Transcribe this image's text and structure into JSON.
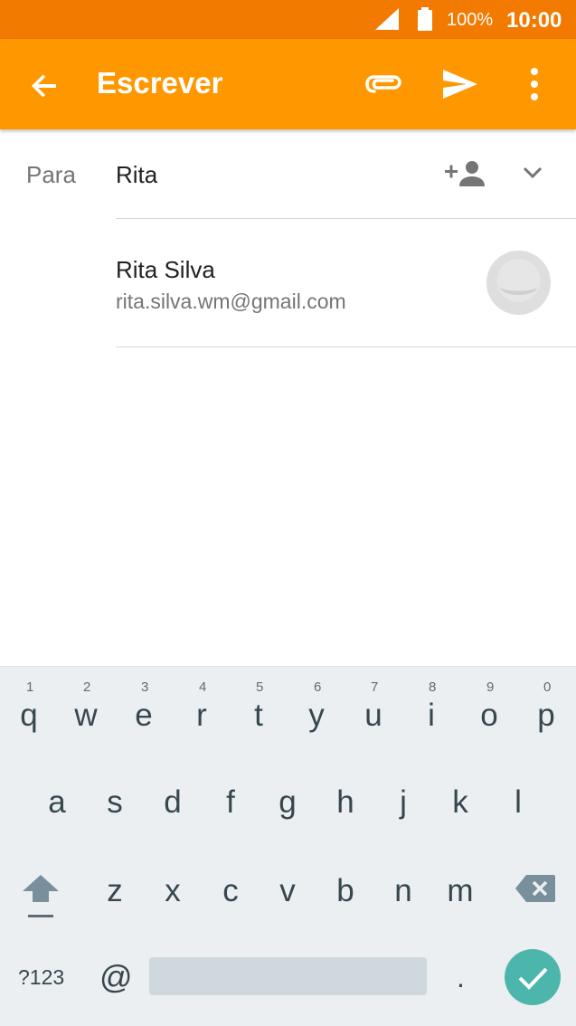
{
  "status_bar": {
    "battery": "100%",
    "time": "10:00"
  },
  "app_bar": {
    "title": "Escrever"
  },
  "compose": {
    "to_label": "Para",
    "to_value": "Rita"
  },
  "suggestion": {
    "name": "Rita Silva",
    "email": "rita.silva.wm@gmail.com"
  },
  "keyboard": {
    "row1": [
      {
        "key": "q",
        "hint": "1"
      },
      {
        "key": "w",
        "hint": "2"
      },
      {
        "key": "e",
        "hint": "3"
      },
      {
        "key": "r",
        "hint": "4"
      },
      {
        "key": "t",
        "hint": "5"
      },
      {
        "key": "y",
        "hint": "6"
      },
      {
        "key": "u",
        "hint": "7"
      },
      {
        "key": "i",
        "hint": "8"
      },
      {
        "key": "o",
        "hint": "9"
      },
      {
        "key": "p",
        "hint": "0"
      }
    ],
    "row2": [
      "a",
      "s",
      "d",
      "f",
      "g",
      "h",
      "j",
      "k",
      "l"
    ],
    "row3": [
      "z",
      "x",
      "c",
      "v",
      "b",
      "n",
      "m"
    ],
    "symbols_label": "?123",
    "at_label": "@",
    "period_label": "."
  },
  "colors": {
    "status_bar": "#f27a00",
    "app_bar": "#ff9800",
    "done_key": "#4db6ac"
  }
}
